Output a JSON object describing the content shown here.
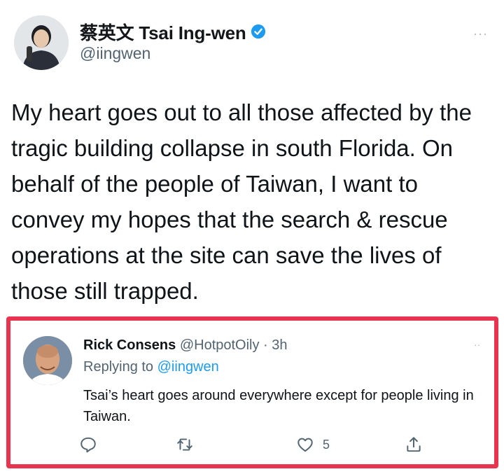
{
  "main_tweet": {
    "display_name": "蔡英文 Tsai Ing-wen",
    "handle": "@iingwen",
    "more": "···",
    "text": "My heart goes out to all those affected by the tragic building collapse in south Florida. On behalf of the people of Taiwan, I want to convey my hopes that the search & rescue operations at the site can save the lives of those still trapped."
  },
  "reply": {
    "name": "Rick Consens",
    "meta": "@HotpotOily · 3h",
    "replying_prefix": "Replying to",
    "replying_handle": "@iingwen",
    "text": "Tsai’s heart goes around everywhere except for people living in Taiwan.",
    "more": "··",
    "actions": {
      "reply_icon": "reply-icon",
      "retweet_icon": "retweet-icon",
      "like_icon": "heart-icon",
      "like_count": "5",
      "share_icon": "share-icon"
    }
  },
  "colors": {
    "highlight_border": "#e8344f",
    "verified_blue": "#1d9bf0",
    "secondary_text": "#536471"
  }
}
